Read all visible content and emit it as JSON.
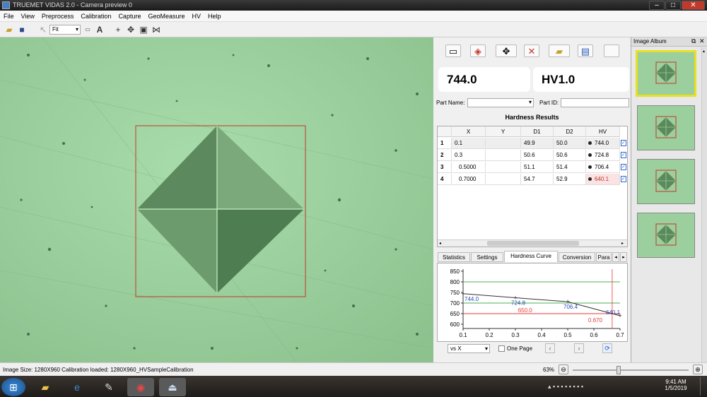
{
  "window": {
    "title": "TRUEMET VIDAS 2.0 - Camera preview 0"
  },
  "menu": [
    "File",
    "View",
    "Preprocess",
    "Calibration",
    "Capture",
    "GeoMeasure",
    "HV",
    "Help"
  ],
  "toolbar": {
    "zoom_select": "Fit"
  },
  "readout": {
    "value": "744.0",
    "scale": "HV1.0"
  },
  "part": {
    "name_label": "Part Name:",
    "id_label": "Part ID:"
  },
  "results": {
    "title": "Hardness Results",
    "columns": [
      "X",
      "Y",
      "D1",
      "D2",
      "HV"
    ],
    "rows": [
      {
        "n": "1",
        "x": "0.1",
        "y": "",
        "d1": "49.9",
        "d2": "50.0",
        "hv": "744.0"
      },
      {
        "n": "2",
        "x": "0.3",
        "y": "",
        "d1": "50.6",
        "d2": "50.6",
        "hv": "724.8"
      },
      {
        "n": "3",
        "x": "0.5000",
        "y": "",
        "d1": "51.1",
        "d2": "51.4",
        "hv": "706.4"
      },
      {
        "n": "4",
        "x": "0.7000",
        "y": "",
        "d1": "54.7",
        "d2": "52.9",
        "hv": "640.1"
      }
    ]
  },
  "tabs": [
    "Statistics",
    "Settings",
    "Hardness Curve",
    "Conversion",
    "Para"
  ],
  "chart_data": {
    "type": "line",
    "x": [
      0.1,
      0.3,
      0.5,
      0.7
    ],
    "series": [
      {
        "values": [
          744.0,
          724.8,
          706.4,
          640.1
        ]
      }
    ],
    "point_labels": [
      "744.0",
      "724.8",
      "706.4",
      "640.1"
    ],
    "xticks": [
      "0.1",
      "0.2",
      "0.3",
      "0.4",
      "0.5",
      "0.6",
      "0.7"
    ],
    "yticks": [
      "850",
      "800",
      "750",
      "700",
      "650",
      "600"
    ],
    "xlim": [
      0.1,
      0.7
    ],
    "ylim": [
      580,
      860
    ],
    "hlines": [
      {
        "y": 800,
        "color": "#4caf50"
      },
      {
        "y": 700,
        "color": "#4caf50"
      },
      {
        "y": 650,
        "color": "#e53935",
        "label": "650.0"
      }
    ],
    "vmarker_label": "0.670"
  },
  "chart_controls": {
    "vs": "vs X",
    "one_page": "One Page"
  },
  "album": {
    "title": "Image Album"
  },
  "status": {
    "left": "Image Size: 1280X960  Calibration loaded: 1280X960_HVSampleCalibration",
    "zoom": "63%"
  },
  "clock": {
    "time": "9:41 AM",
    "date": "1/5/2019"
  },
  "colors": {
    "viewer": "#9ccf9e",
    "selection": "#e8e021",
    "roi": "#c0392b"
  }
}
